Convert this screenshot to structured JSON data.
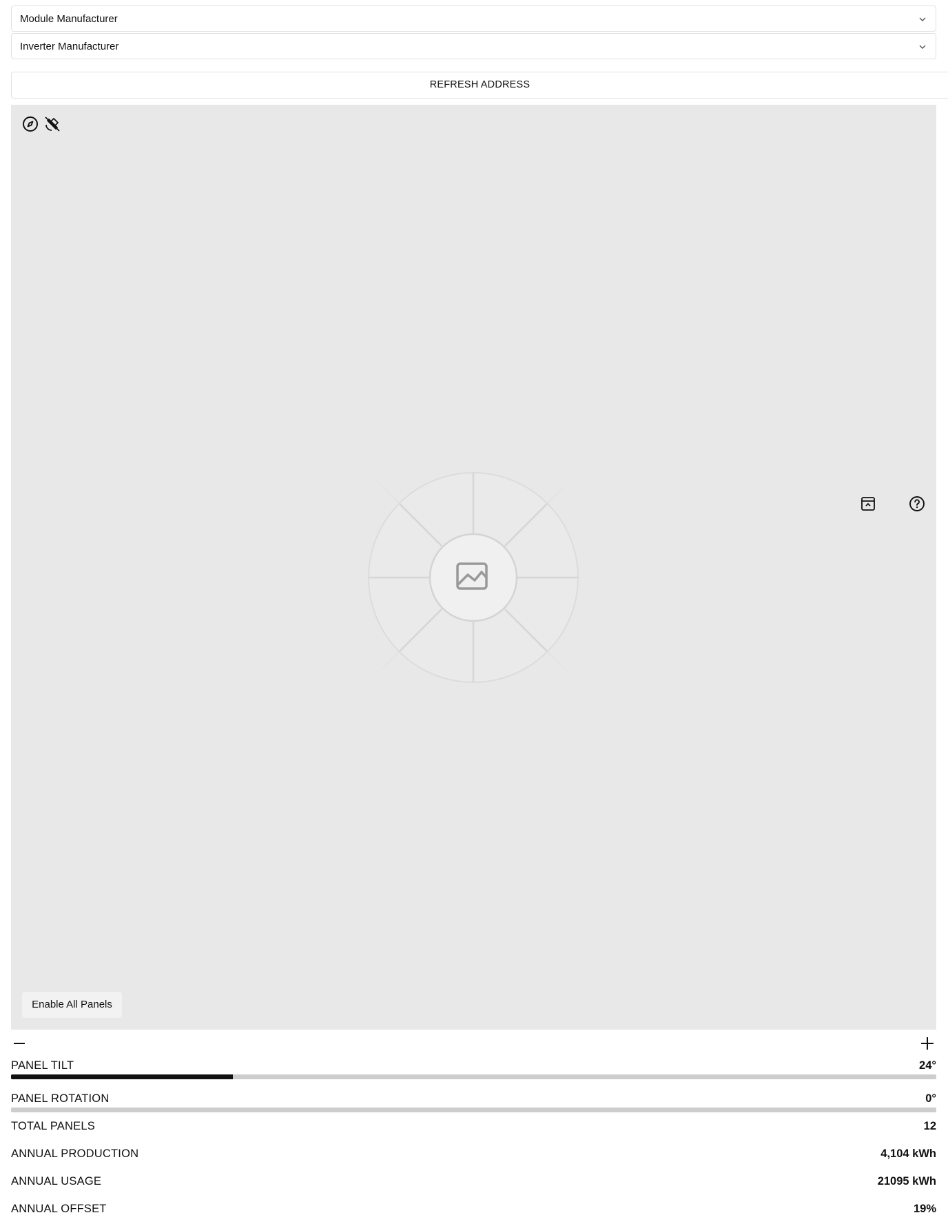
{
  "selects": {
    "module": "Module Manufacturer",
    "inverter": "Inverter Manufacturer"
  },
  "refresh_label": "REFRESH ADDRESS",
  "map": {
    "top_left_icons": [
      "compass-icon",
      "satellite-off-icon"
    ],
    "right_icons": [
      "collapse-panel-icon",
      "help-icon"
    ],
    "placeholder_icon": "image-placeholder-icon",
    "enable_all_label": "Enable All Panels",
    "zoom_out_icon": "minus-icon",
    "zoom_in_icon": "plus-icon"
  },
  "controls": {
    "tilt": {
      "label": "PANEL TILT",
      "value": "24°",
      "fraction": 0.24
    },
    "rotation": {
      "label": "PANEL ROTATION",
      "value": "0°",
      "fraction": 0
    }
  },
  "stats": [
    {
      "label": "TOTAL PANELS",
      "value": "12"
    },
    {
      "label": "ANNUAL PRODUCTION",
      "value": "4,104 kWh"
    },
    {
      "label": "ANNUAL USAGE",
      "value": "21095 kWh"
    },
    {
      "label": "ANNUAL OFFSET",
      "value": "19%"
    }
  ],
  "colors": {
    "map_background": "#e8e8e8",
    "slider_fill": "#111111",
    "slider_track": "#cdcdcd"
  }
}
